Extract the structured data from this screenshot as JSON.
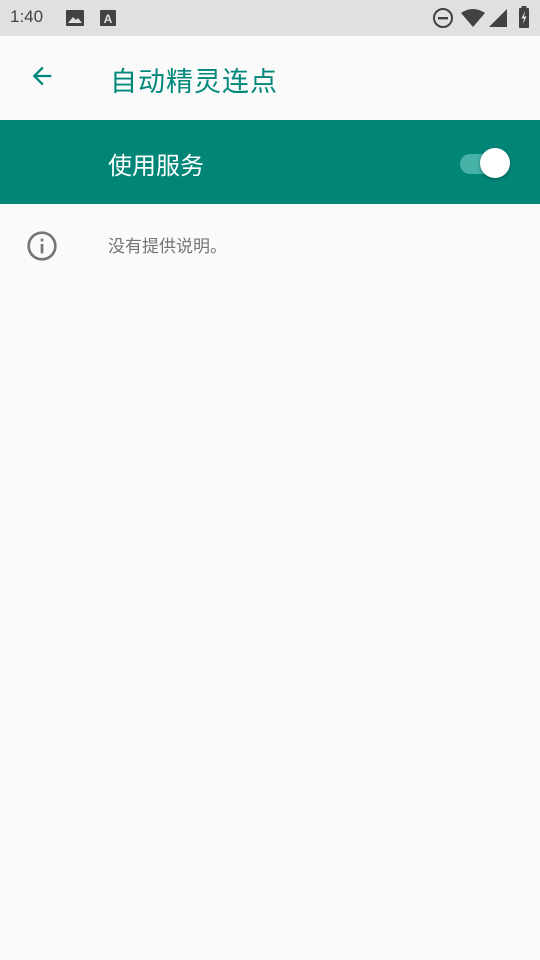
{
  "status_bar": {
    "time": "1:40",
    "left_icons": [
      "image-icon",
      "text-a-icon"
    ],
    "right_icons": [
      "do-not-disturb-icon",
      "wifi-icon",
      "signal-icon",
      "battery-icon"
    ]
  },
  "app_bar": {
    "back_icon": "arrow-back-icon",
    "title": "自动精灵连点"
  },
  "master_switch": {
    "label": "使用服务",
    "on": true
  },
  "info": {
    "icon": "info-icon",
    "text": "没有提供说明。"
  },
  "colors": {
    "accent": "#00897b",
    "master_bg": "#008577",
    "background": "#fafafa",
    "status_bar_bg": "#e0e0e0",
    "secondary_text": "#757575"
  }
}
